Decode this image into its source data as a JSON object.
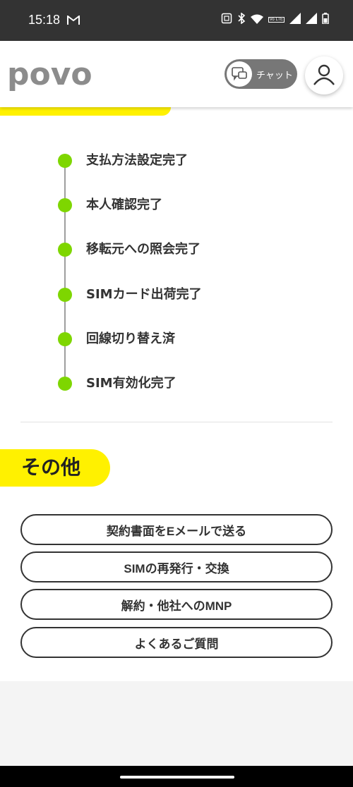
{
  "status_bar": {
    "time": "15:18",
    "mail_icon": "gmail-icon",
    "lte_label": "Vo LTE",
    "icons": [
      "nfc-icon",
      "bluetooth-icon",
      "wifi-icon",
      "signal-icon",
      "signal-icon",
      "battery-icon"
    ]
  },
  "header": {
    "logo_text": "povo",
    "chat_label": "チャット",
    "chat_icon": "chat-icon",
    "user_icon": "user-icon"
  },
  "timeline": {
    "steps": [
      {
        "label": "支払方法設定完了"
      },
      {
        "label": "本人確認完了"
      },
      {
        "label": "移転元への照会完了"
      },
      {
        "label": "SIMカード出荷完了"
      },
      {
        "label": "回線切り替え済"
      },
      {
        "label": "SIM有効化完了"
      }
    ]
  },
  "other_section": {
    "title": "その他",
    "buttons": [
      {
        "label": "契約書面をEメールで送る"
      },
      {
        "label": "SIMの再発行・交換"
      },
      {
        "label": "解約・他社へのMNP"
      },
      {
        "label": "よくあるご質問"
      }
    ]
  },
  "colors": {
    "accent_yellow": "#fff100",
    "status_green": "#7ed600",
    "status_bar_bg": "#333333"
  }
}
